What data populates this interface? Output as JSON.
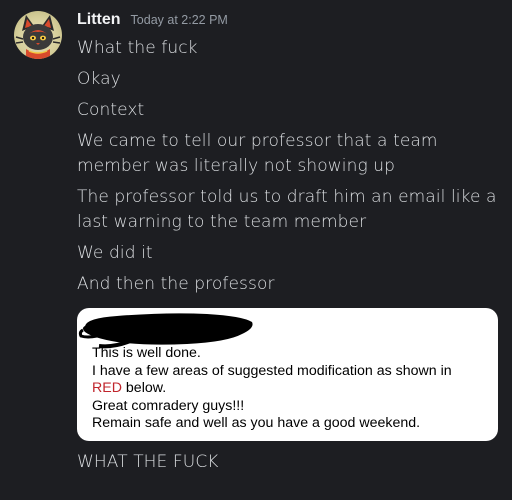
{
  "message": {
    "author": "Litten",
    "timestamp": "Today at 2:22 PM",
    "lines": [
      "What the fuck",
      "Okay",
      "Context",
      "We came to tell our professor that a team member was literally not showing up",
      "The professor told us to draft him an email like a last warning to the team member",
      "We did it",
      "And then the professor"
    ],
    "final_line": "WHAT THE FUCK"
  },
  "attachment": {
    "line1": "This is well done.",
    "line2": "I have a few areas of suggested modification as shown in",
    "line3_red": "RED",
    "line3_rest": " below.",
    "line4": "Great comradery guys!!!",
    "line5": "Remain safe and well as you have a good weekend."
  },
  "colors": {
    "background": "#1d1e22",
    "username": "#f2f3f5",
    "timestamp": "#949ba4",
    "message_text": "#dbdee1",
    "red_text": "#c0252c"
  },
  "icons": {
    "avatar": "litten-cat-avatar"
  }
}
